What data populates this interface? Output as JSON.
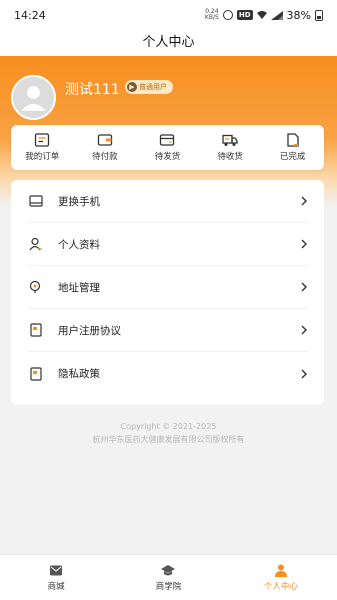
{
  "status_bar": {
    "time": "14:24",
    "net_speed_value": "0.24",
    "net_speed_unit": "KB/S",
    "hd_label": "HD",
    "battery": "38%"
  },
  "nav": {
    "title": "个人中心"
  },
  "profile": {
    "username": "测试111",
    "badge": "普通用户"
  },
  "orders": [
    {
      "label": "我的订单",
      "icon": "order-list-icon"
    },
    {
      "label": "待付款",
      "icon": "wallet-icon"
    },
    {
      "label": "待发货",
      "icon": "package-icon"
    },
    {
      "label": "待收货",
      "icon": "truck-icon"
    },
    {
      "label": "已完成",
      "icon": "document-done-icon"
    }
  ],
  "menu": [
    {
      "label": "更换手机",
      "icon": "tablet-icon"
    },
    {
      "label": "个人资料",
      "icon": "user-icon"
    },
    {
      "label": "地址管理",
      "icon": "location-icon"
    },
    {
      "label": "用户注册协议",
      "icon": "agreement-icon"
    },
    {
      "label": "隐私政策",
      "icon": "privacy-icon"
    }
  ],
  "copyright": {
    "line1": "Copyright © 2021-2025",
    "line2": "杭州华东医药大健康发展有限公司版权所有"
  },
  "tabs": [
    {
      "label": "商城",
      "icon": "mail-icon",
      "active": false
    },
    {
      "label": "商学院",
      "icon": "graduation-cap-icon",
      "active": false
    },
    {
      "label": "个人中心",
      "icon": "person-icon",
      "active": true
    }
  ],
  "colors": {
    "accent": "#f78e1e",
    "badge_bg": "#fde8c4"
  }
}
